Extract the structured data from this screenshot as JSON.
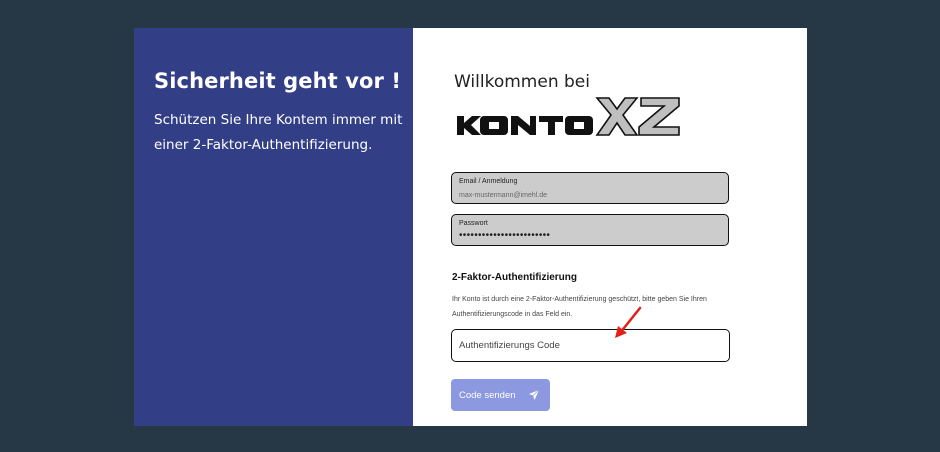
{
  "left_panel": {
    "heading": "Sicherheit geht vor !",
    "subtext": "Schützen Sie Ihre Kontem immer mit einer 2-Faktor-Authentifizierung."
  },
  "welcome_text": "Willkommen bei",
  "logo": {
    "text": "KONTOXZ"
  },
  "email_field": {
    "label": "Email / Anmeldung",
    "value": "max-mustermann@imehl.de"
  },
  "password_field": {
    "label": "Passwort",
    "value": "••••••••••••••••••••••••"
  },
  "two_factor": {
    "title": "2-Faktor-Authentifizierung",
    "description": "Ihr Konto ist durch eine 2-Faktor-Authentifizierung geschützt, bitte geben Sie Ihren Authentifizierungscode in das Feld ein.",
    "input_placeholder": "Authentifizierungs Code",
    "button_label": "Code senden"
  },
  "colors": {
    "background": "#263846",
    "left_panel": "#323f87",
    "button": "#8c98e0",
    "annotation_arrow": "#e0211a"
  },
  "icons": {
    "send": "paper-plane-icon",
    "annotation": "red-arrow-icon"
  }
}
